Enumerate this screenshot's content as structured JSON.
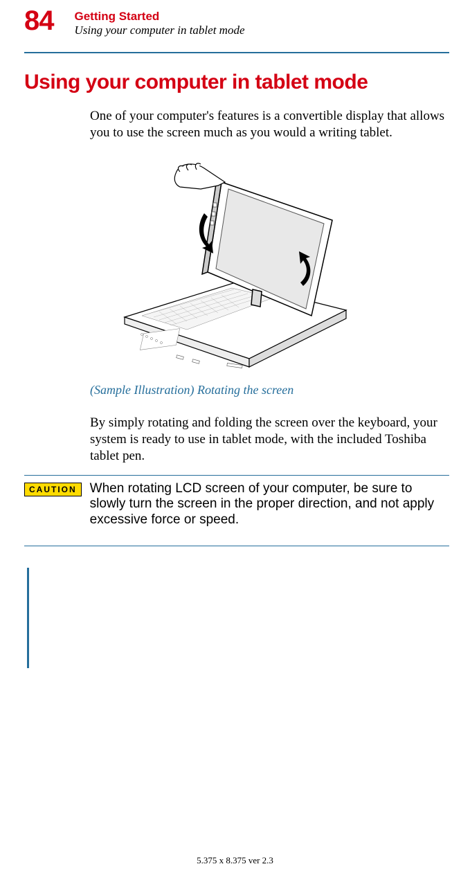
{
  "page_number": "84",
  "chapter_title": "Getting Started",
  "section_ref": "Using your computer in tablet mode",
  "section_heading": "Using your computer in tablet mode",
  "intro_paragraph": "One of your computer's features is a convertible display that allows you to use the screen much as you would a writing tablet.",
  "illustration_caption": "(Sample Illustration) Rotating the screen",
  "body_paragraph": "By simply rotating and folding the screen over the keyboard, your system is ready to use in tablet mode, with the included Toshiba tablet pen.",
  "caution_label": "CAUTION",
  "caution_text": "When rotating LCD screen of your computer, be sure to slowly turn the screen in the proper direction, and not apply excessive force or speed.",
  "footer_text": "5.375 x 8.375 ver 2.3"
}
